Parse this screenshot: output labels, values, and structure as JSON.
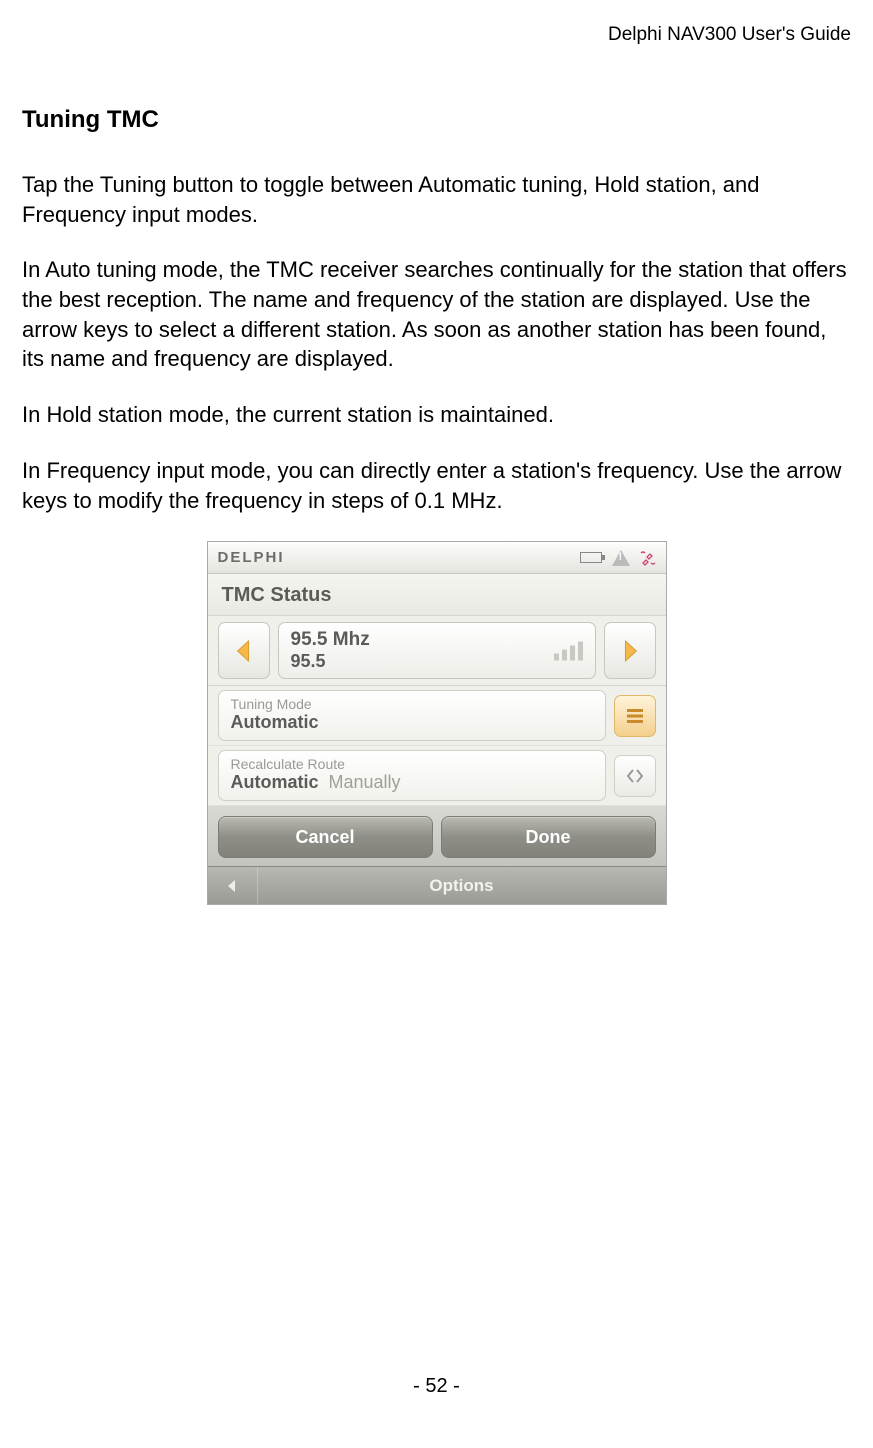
{
  "header": {
    "doc_title": "Delphi NAV300 User's Guide"
  },
  "heading": "Tuning TMC",
  "paragraphs": {
    "p1": "Tap the Tuning button to toggle between Automatic tuning, Hold station, and Frequency input modes.",
    "p2": "In Auto tuning mode, the TMC receiver searches continually for the station that offers the best reception. The name and frequency of the station are displayed. Use the arrow keys to select a different station. As soon as another station has been found, its name and frequency are displayed.",
    "p3": "In Hold station mode, the current station is maintained.",
    "p4": "In Frequency input mode, you can directly enter a station's frequency. Use the arrow keys to modify the frequency in steps of 0.1 MHz."
  },
  "device": {
    "brand": "DELPHI",
    "screen_title": "TMC Status",
    "frequency": {
      "line1": "95.5 Mhz",
      "line2": "95.5"
    },
    "tuning_mode": {
      "label": "Tuning Mode",
      "value": "Automatic"
    },
    "recalc_route": {
      "label": "Recalculate Route",
      "value_primary": "Automatic",
      "value_secondary": "Manually"
    },
    "buttons": {
      "cancel": "Cancel",
      "done": "Done"
    },
    "bottom": {
      "label": "Options"
    }
  },
  "footer": {
    "page": "- 52 -"
  }
}
